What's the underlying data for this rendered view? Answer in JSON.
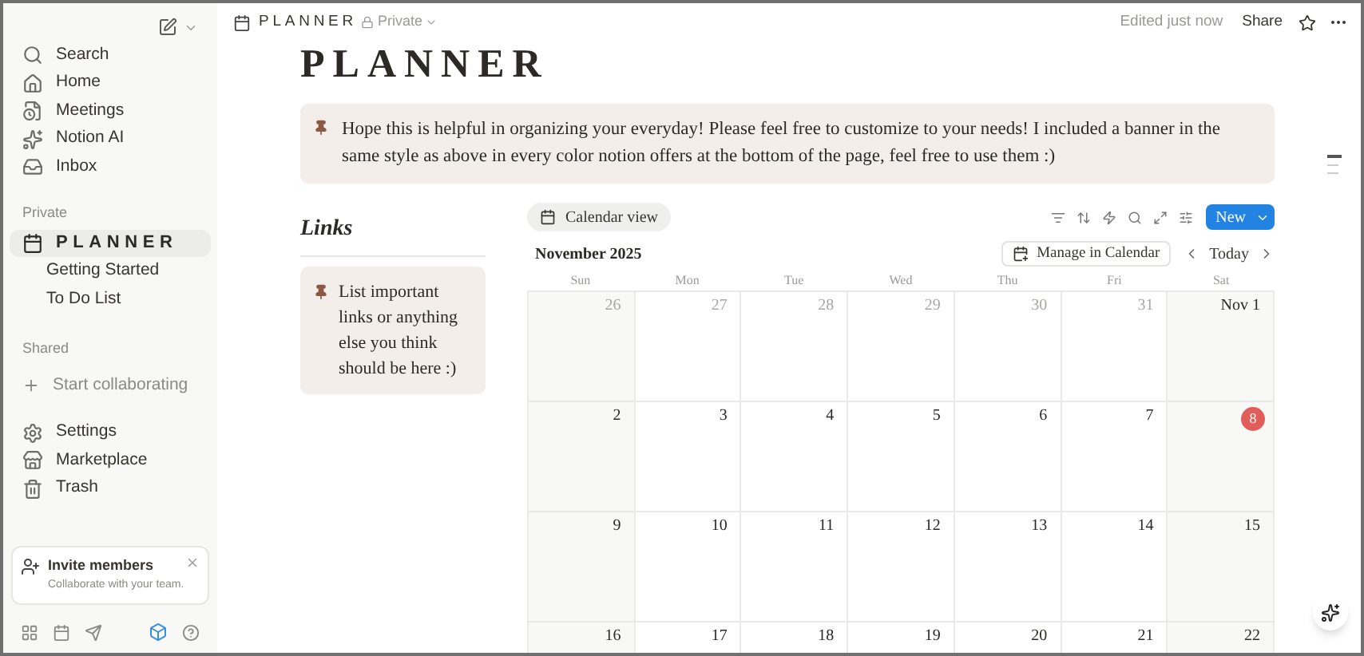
{
  "sidebar": {
    "nav": [
      {
        "label": "Search"
      },
      {
        "label": "Home"
      },
      {
        "label": "Meetings"
      },
      {
        "label": "Notion AI"
      },
      {
        "label": "Inbox"
      }
    ],
    "private": {
      "heading": "Private",
      "pages": [
        {
          "label": "PLANNER",
          "selected": true,
          "children": [
            {
              "label": "Getting Started",
              "selected": false
            },
            {
              "label": "To Do List",
              "selected": false
            }
          ]
        }
      ]
    },
    "shared": {
      "heading": "Shared",
      "action": "Start collaborating"
    },
    "footer_nav": [
      {
        "label": "Settings"
      },
      {
        "label": "Marketplace"
      },
      {
        "label": "Trash"
      }
    ],
    "invite": {
      "title": "Invite members",
      "subtitle": "Collaborate with your team."
    }
  },
  "topbar": {
    "breadcrumb": "PLANNER",
    "privacy": "Private",
    "edited": "Edited just now",
    "share": "Share"
  },
  "page": {
    "title": "PLANNER",
    "callout": "Hope this is helpful in organizing your everyday! Please feel free to customize to your needs! I included a banner in the same style as above in every color notion offers at the bottom of the page, feel free to use them :)",
    "links": {
      "heading": "Links",
      "callout": "List important links or anything else you think should be here :)"
    }
  },
  "calendar": {
    "view": "Calendar view",
    "new_button": "New",
    "month": "November 2025",
    "manage": "Manage in Calendar",
    "today": "Today",
    "weekdays": [
      "Sun",
      "Mon",
      "Tue",
      "Wed",
      "Thu",
      "Fri",
      "Sat"
    ],
    "weeks": [
      [
        {
          "label": "26",
          "muted": true,
          "today": false
        },
        {
          "label": "27",
          "muted": true,
          "today": false
        },
        {
          "label": "28",
          "muted": true,
          "today": false
        },
        {
          "label": "29",
          "muted": true,
          "today": false
        },
        {
          "label": "30",
          "muted": true,
          "today": false
        },
        {
          "label": "31",
          "muted": true,
          "today": false
        },
        {
          "label": "Nov 1",
          "muted": false,
          "today": false
        }
      ],
      [
        {
          "label": "2",
          "muted": false,
          "today": false
        },
        {
          "label": "3",
          "muted": false,
          "today": false
        },
        {
          "label": "4",
          "muted": false,
          "today": false
        },
        {
          "label": "5",
          "muted": false,
          "today": false
        },
        {
          "label": "6",
          "muted": false,
          "today": false
        },
        {
          "label": "7",
          "muted": false,
          "today": false
        },
        {
          "label": "8",
          "muted": false,
          "today": true
        }
      ],
      [
        {
          "label": "9",
          "muted": false,
          "today": false
        },
        {
          "label": "10",
          "muted": false,
          "today": false
        },
        {
          "label": "11",
          "muted": false,
          "today": false
        },
        {
          "label": "12",
          "muted": false,
          "today": false
        },
        {
          "label": "13",
          "muted": false,
          "today": false
        },
        {
          "label": "14",
          "muted": false,
          "today": false
        },
        {
          "label": "15",
          "muted": false,
          "today": false
        }
      ],
      [
        {
          "label": "16",
          "muted": false,
          "today": false
        },
        {
          "label": "17",
          "muted": false,
          "today": false
        },
        {
          "label": "18",
          "muted": false,
          "today": false
        },
        {
          "label": "19",
          "muted": false,
          "today": false
        },
        {
          "label": "20",
          "muted": false,
          "today": false
        },
        {
          "label": "21",
          "muted": false,
          "today": false
        },
        {
          "label": "22",
          "muted": false,
          "today": false
        }
      ]
    ]
  }
}
